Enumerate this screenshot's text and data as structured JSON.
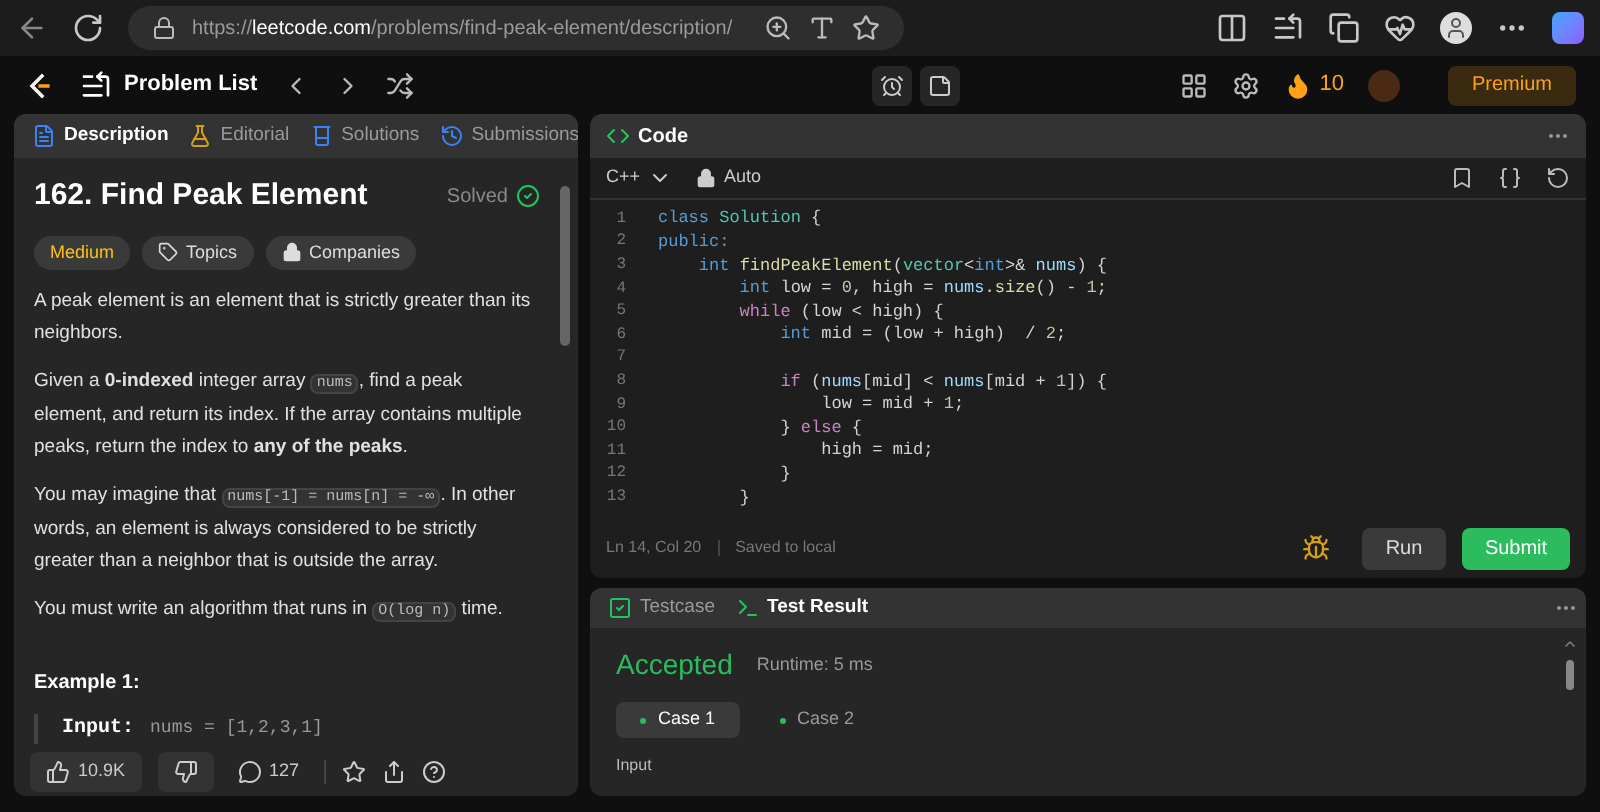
{
  "browser": {
    "url_prefix": "https://",
    "url_domain": "leetcode.com",
    "url_path": "/problems/find-peak-element/description/"
  },
  "nav": {
    "problem_list": "Problem List",
    "streak": "10",
    "premium": "Premium"
  },
  "left_tabs": [
    {
      "label": "Description",
      "selected": true,
      "kind": "description"
    },
    {
      "label": "Editorial",
      "selected": false,
      "kind": "editorial"
    },
    {
      "label": "Solutions",
      "selected": false,
      "kind": "solutions"
    },
    {
      "label": "Submissions",
      "selected": false,
      "kind": "submissions"
    }
  ],
  "problem": {
    "title": "162. Find Peak Element",
    "status": "Solved",
    "difficulty": "Medium",
    "tags": [
      {
        "label": "Topics",
        "kind": "tag"
      },
      {
        "label": "Companies",
        "kind": "lock"
      }
    ],
    "paragraphs": [
      [
        {
          "kind": "text",
          "text": "A peak element is an element that is strictly greater than its neighbors."
        }
      ],
      [
        {
          "kind": "text",
          "text": "Given a **0-indexed** integer array "
        },
        {
          "kind": "code",
          "text": "nums"
        },
        {
          "kind": "text",
          "text": ", find a peak element, and return its index. If the array contains multiple peaks, return the index to **any of the peaks**."
        }
      ],
      [
        {
          "kind": "text",
          "text": "You may imagine that "
        },
        {
          "kind": "code",
          "text": "nums[-1] = nums[n] = -∞"
        },
        {
          "kind": "text",
          "text": ". In other words, an element is always considered to be strictly greater than a neighbor that is outside the array."
        }
      ],
      [
        {
          "kind": "text",
          "text": "You must write an algorithm that runs in "
        },
        {
          "kind": "code",
          "text": "O(log n)"
        },
        {
          "kind": "text",
          "text": " time."
        }
      ]
    ],
    "example_title": "Example 1:",
    "example_label": "Input:",
    "example_value": "nums = [1,2,3,1]"
  },
  "footer": {
    "likes": "10.9K",
    "comments": "127"
  },
  "code_panel": {
    "title": "Code",
    "language": "C++",
    "mode": "Auto",
    "status_position": "Ln 14, Col 20",
    "status_saved": "Saved to local",
    "run": "Run",
    "submit": "Submit",
    "lines": [
      {
        "number": "1",
        "tokens": [
          {
            "kind": "keyword",
            "text": "class "
          },
          {
            "kind": "type",
            "text": "Solution"
          },
          {
            "kind": "plain",
            "text": " {"
          }
        ]
      },
      {
        "number": "2",
        "tokens": [
          {
            "kind": "keyword",
            "text": "public:"
          }
        ]
      },
      {
        "number": "3",
        "tokens": [
          {
            "kind": "keyword",
            "text": "    int "
          },
          {
            "kind": "function",
            "text": "findPeakElement"
          },
          {
            "kind": "plain",
            "text": "("
          },
          {
            "kind": "type",
            "text": "vector"
          },
          {
            "kind": "plain",
            "text": "<"
          },
          {
            "kind": "keyword",
            "text": "int"
          },
          {
            "kind": "plain",
            "text": ">& "
          },
          {
            "kind": "variable",
            "text": "nums"
          },
          {
            "kind": "plain",
            "text": ") {"
          }
        ]
      },
      {
        "number": "4",
        "tokens": [
          {
            "kind": "keyword",
            "text": "        int "
          },
          {
            "kind": "plain",
            "text": "low = "
          },
          {
            "kind": "number",
            "text": "0"
          },
          {
            "kind": "plain",
            "text": ", high = "
          },
          {
            "kind": "variable",
            "text": "nums"
          },
          {
            "kind": "plain",
            "text": "."
          },
          {
            "kind": "function",
            "text": "size"
          },
          {
            "kind": "plain",
            "text": "() - "
          },
          {
            "kind": "number",
            "text": "1"
          },
          {
            "kind": "plain",
            "text": ";"
          }
        ]
      },
      {
        "number": "5",
        "tokens": [
          {
            "kind": "control",
            "text": "        while"
          },
          {
            "kind": "plain",
            "text": " (low < high) {"
          }
        ]
      },
      {
        "number": "6",
        "tokens": [
          {
            "kind": "keyword",
            "text": "            int "
          },
          {
            "kind": "plain",
            "text": "mid = (low + high)  / "
          },
          {
            "kind": "number",
            "text": "2"
          },
          {
            "kind": "plain",
            "text": ";"
          }
        ]
      },
      {
        "number": "7"
      },
      {
        "number": "8",
        "tokens": [
          {
            "kind": "control",
            "text": "            if"
          },
          {
            "kind": "plain",
            "text": " ("
          },
          {
            "kind": "variable",
            "text": "nums"
          },
          {
            "kind": "plain",
            "text": "[mid] < "
          },
          {
            "kind": "variable",
            "text": "nums"
          },
          {
            "kind": "plain",
            "text": "[mid + "
          },
          {
            "kind": "number",
            "text": "1"
          },
          {
            "kind": "plain",
            "text": "]) {"
          }
        ]
      },
      {
        "number": "9",
        "tokens": [
          {
            "kind": "plain",
            "text": "                low = mid + "
          },
          {
            "kind": "number",
            "text": "1"
          },
          {
            "kind": "plain",
            "text": ";"
          }
        ]
      },
      {
        "number": "10",
        "tokens": [
          {
            "kind": "plain",
            "text": "            } "
          },
          {
            "kind": "control",
            "text": "else"
          },
          {
            "kind": "plain",
            "text": " {"
          }
        ]
      },
      {
        "number": "11",
        "tokens": [
          {
            "kind": "plain",
            "text": "                high = mid;"
          }
        ]
      },
      {
        "number": "12",
        "tokens": [
          {
            "kind": "plain",
            "text": "            }"
          }
        ]
      },
      {
        "number": "13",
        "tokens": [
          {
            "kind": "plain",
            "text": "        }"
          }
        ]
      }
    ]
  },
  "test_tabs": [
    {
      "label": "Testcase",
      "selected": false,
      "kind": "testcase"
    },
    {
      "label": "Test Result",
      "selected": true,
      "kind": "result"
    }
  ],
  "result": {
    "verdict": "Accepted",
    "runtime": "Runtime: 5 ms",
    "cases": [
      {
        "label": "Case 1",
        "selected": true
      },
      {
        "label": "Case 2",
        "selected": false
      }
    ],
    "input_label": "Input"
  }
}
